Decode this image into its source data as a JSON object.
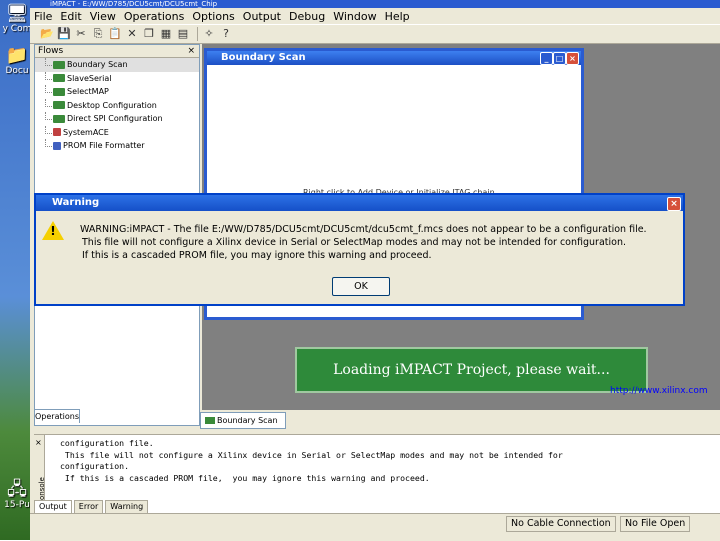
{
  "desktop": {
    "icons": [
      {
        "label": "y Com",
        "glyph": "🖥"
      },
      {
        "label": "Docu",
        "glyph": "📁"
      },
      {
        "label": "15-Pu",
        "glyph": "🖧"
      }
    ]
  },
  "app": {
    "title": "iMPACT - E:/WW/D785/DCU5cmt/DCU5cmt_Chip",
    "menu": [
      "File",
      "Edit",
      "View",
      "Operations",
      "Options",
      "Output",
      "Debug",
      "Window",
      "Help"
    ],
    "toolbar_icons": [
      "open-icon",
      "save-icon",
      "cut-icon",
      "copy-icon",
      "paste-icon",
      "delete-icon",
      "cascade-icon",
      "tile-icon",
      "arrange-icon",
      "sep",
      "magic-icon",
      "help-icon"
    ]
  },
  "flows": {
    "title": "Flows",
    "close": "×",
    "items": [
      "Boundary Scan",
      "SlaveSerial",
      "SelectMAP",
      "Desktop Configuration",
      "Direct SPI Configuration",
      "SystemACE",
      "PROM File Formatter"
    ],
    "selected_index": 0,
    "tab": "Operations"
  },
  "boundary_scan": {
    "title": "Boundary Scan",
    "hint": "Right click to Add Device or Initialize JTAG chain",
    "tab": "Boundary Scan"
  },
  "warning_dialog": {
    "title": "Warning",
    "close": "×",
    "lines": [
      "WARNING:iMPACT  - The file  E:/WW/D785/DCU5cmt/DCU5cmt/dcu5cmt_f.mcs  does not appear to be a configuration file.",
      "This file will not configure a Xilinx device in Serial or SelectMap modes and may not be intended for configuration.",
      "If this is a cascaded PROM file,  you may ignore this warning and proceed."
    ],
    "ok_label": "OK"
  },
  "loading_splash": {
    "text": "Loading iMPACT Project, please wait..."
  },
  "xilinx_link": "http://www.xilinx.com",
  "console": {
    "close": "×",
    "side_label": "Console",
    "lines": [
      "configuration file.",
      " This file will not configure a Xilinx device in Serial or SelectMap modes and may not be intended for",
      "configuration.",
      " If this is a cascaded PROM file,  you may ignore this warning and proceed."
    ],
    "tabs": [
      "Output",
      "Error",
      "Warning"
    ],
    "active_tab": 0
  },
  "status_bar": {
    "cable": "No Cable Connection",
    "file": "No File Open"
  },
  "colors": {
    "titlebar_blue": "#2a5bd0",
    "splash_green": "#2e8a3a",
    "warning_yellow": "#f5d000"
  }
}
